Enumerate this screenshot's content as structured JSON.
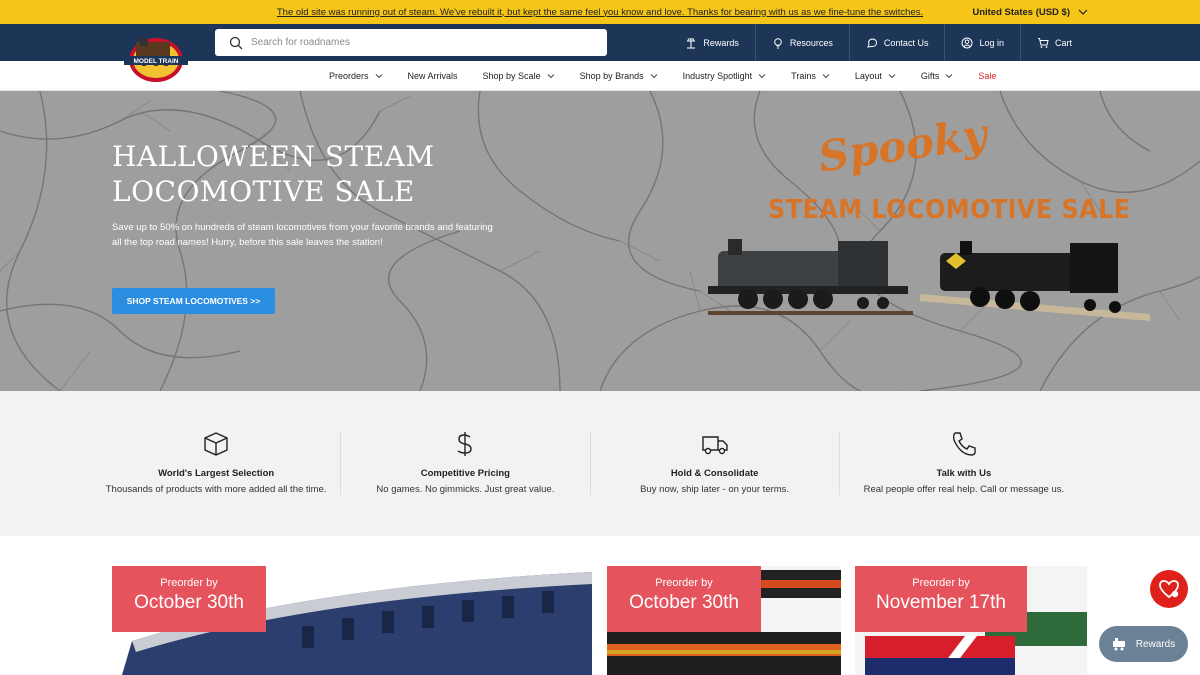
{
  "announcement": {
    "text": "The old site was running out of steam. We've rebuilt it, but kept the same feel you know and love. Thanks for bearing with us as we fine-tune the switches.",
    "country": "United States (USD $)"
  },
  "header": {
    "search_placeholder": "Search for roadnames",
    "nav": [
      {
        "label": "Rewards",
        "icon": "rewards-icon"
      },
      {
        "label": "Resources",
        "icon": "lightbulb-icon"
      },
      {
        "label": "Contact Us",
        "icon": "chat-icon"
      },
      {
        "label": "Log in",
        "icon": "user-icon"
      },
      {
        "label": "Cart",
        "icon": "cart-icon"
      }
    ],
    "logo_text": "MODEL TRAIN"
  },
  "menu": [
    {
      "label": "Preorders",
      "dropdown": true
    },
    {
      "label": "New Arrivals",
      "dropdown": false
    },
    {
      "label": "Shop by Scale",
      "dropdown": true
    },
    {
      "label": "Shop by Brands",
      "dropdown": true
    },
    {
      "label": "Industry Spotlight",
      "dropdown": true
    },
    {
      "label": "Trains",
      "dropdown": true
    },
    {
      "label": "Layout",
      "dropdown": true
    },
    {
      "label": "Gifts",
      "dropdown": true
    },
    {
      "label": "Sale",
      "dropdown": false
    }
  ],
  "hero": {
    "title": "HALLOWEEN STEAM LOCOMOTIVE SALE",
    "subtitle": "Save up to 50% on hundreds of steam locomotives from your favorite brands and featuring all the top road names! Hurry, before this sale leaves the station!",
    "button": "SHOP STEAM LOCOMOTIVES >>",
    "graphic_line1": "Spooky",
    "graphic_line2": "STEAM LOCOMOTIVE SALE"
  },
  "features": [
    {
      "title": "World's Largest Selection",
      "desc": "Thousands of products with more added all the time.",
      "icon": "box-icon"
    },
    {
      "title": "Competitive Pricing",
      "desc": "No games. No gimmicks. Just great value.",
      "icon": "dollar-icon"
    },
    {
      "title": "Hold & Consolidate",
      "desc": "Buy now, ship later - on your terms.",
      "icon": "truck-icon"
    },
    {
      "title": "Talk with Us",
      "desc": "Real people offer real help. Call or message us.",
      "icon": "phone-icon"
    }
  ],
  "products": [
    {
      "badge_top": "Preorder by",
      "badge_date": "October 30th"
    },
    {
      "badge_top": "Preorder by",
      "badge_date": "October 30th"
    },
    {
      "badge_top": "Preorder by",
      "badge_date": "November 17th"
    }
  ],
  "floating": {
    "rewards_label": "Rewards"
  },
  "colors": {
    "announce_bg": "#f5c518",
    "header_bg": "#1d3557",
    "accent_blue": "#2b8de0",
    "badge_red": "#e5535d",
    "sale_red": "#d62828"
  }
}
